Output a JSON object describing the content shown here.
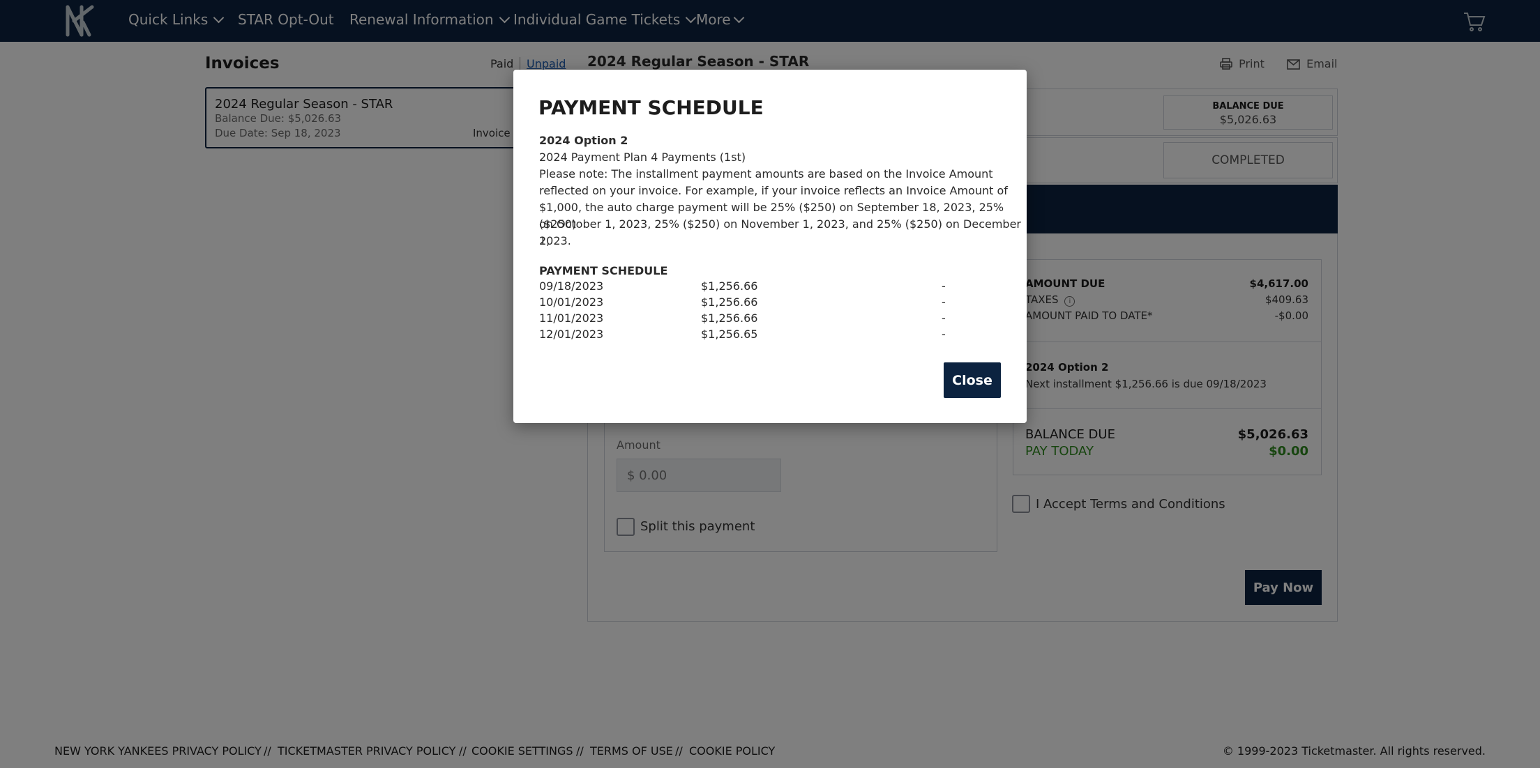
{
  "nav": {
    "items": [
      {
        "label": "Quick Links",
        "dropdown": true
      },
      {
        "label": "STAR Opt-Out",
        "dropdown": false
      },
      {
        "label": "Renewal Information",
        "dropdown": true
      },
      {
        "label": "Individual Game Tickets",
        "dropdown": true
      },
      {
        "label": "More",
        "dropdown": true
      }
    ],
    "brand_color": "#0c2340"
  },
  "invoices": {
    "heading": "Invoices",
    "filter_paid": "Paid",
    "filter_unpaid": "Unpaid",
    "item": {
      "title": "2024 Regular Season - STAR",
      "balance": "Balance Due: $5,026.63",
      "due_date": "Due Date: Sep 18, 2023",
      "invoice_label": "Invoice"
    }
  },
  "detail": {
    "title": "2024 Regular Season - STAR",
    "print_label": "Print",
    "email_label": "Email",
    "balance_due_label": "BALANCE DUE",
    "balance_due_value": "$5,026.63",
    "status": "COMPLETED",
    "amount_label": "Amount",
    "amount_placeholder": "$ 0.00",
    "split_label": "Split this payment",
    "summary": {
      "amount_due_label": "AMOUNT DUE",
      "amount_due_value": "$4,617.00",
      "taxes_label": "TAXES",
      "taxes_value": "$409.63",
      "paid_label": "AMOUNT PAID TO DATE*",
      "paid_value": "-$0.00",
      "option_title": "2024 Option 2",
      "next_installment": "Next installment $1,256.66 is due 09/18/2023",
      "balance_label": "BALANCE DUE",
      "balance_value": "$5,026.63",
      "pay_today_label": "PAY TODAY",
      "pay_today_value": "$0.00"
    },
    "terms_label": "I Accept Terms and Conditions",
    "pay_now_label": "Pay Now"
  },
  "modal": {
    "title": "PAYMENT SCHEDULE",
    "option": "2024 Option 2",
    "plan": "2024 Payment Plan 4 Payments (1st)",
    "note_lines": [
      "Please note: The installment payment amounts are based on the Invoice Amount",
      "reflected on your invoice. For example, if your invoice reflects an Invoice Amount of",
      "$1,000, the auto charge payment will be 25% ($250) on September 18, 2023, 25% ($250)",
      "on October 1, 2023, 25% ($250) on November 1, 2023, and 25% ($250) on December 1,",
      "2023."
    ],
    "schedule_heading": "PAYMENT SCHEDULE",
    "schedule": [
      {
        "date": "09/18/2023",
        "amount": "$1,256.66",
        "status": "-"
      },
      {
        "date": "10/01/2023",
        "amount": "$1,256.66",
        "status": "-"
      },
      {
        "date": "11/01/2023",
        "amount": "$1,256.66",
        "status": "-"
      },
      {
        "date": "12/01/2023",
        "amount": "$1,256.65",
        "status": "-"
      }
    ],
    "close_label": "Close"
  },
  "footer": {
    "links": [
      "NEW YORK YANKEES PRIVACY POLICY",
      "TICKETMASTER PRIVACY POLICY",
      "COOKIE SETTINGS",
      "TERMS OF USE",
      "COOKIE POLICY"
    ],
    "separator": "//",
    "copyright": "© 1999-2023 Ticketmaster. All rights reserved."
  }
}
